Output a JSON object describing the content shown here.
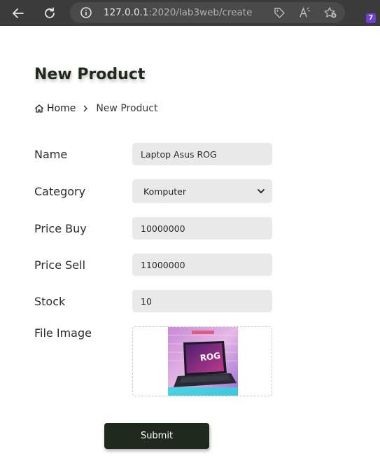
{
  "browser": {
    "url_host": "127.0.0.1",
    "url_rest": ":2020/lab3web/create",
    "extension_badge": "7"
  },
  "page": {
    "title": "New Product",
    "breadcrumb": {
      "home": "Home",
      "current": "New Product"
    }
  },
  "form": {
    "name_label": "Name",
    "name_value": "Laptop Asus ROG",
    "category_label": "Category",
    "category_value": "Komputer",
    "price_buy_label": "Price Buy",
    "price_buy_value": "10000000",
    "price_sell_label": "Price Sell",
    "price_sell_value": "11000000",
    "stock_label": "Stock",
    "stock_value": "10",
    "file_image_label": "File Image",
    "submit_label": "Submit"
  },
  "colors": {
    "primary": "#1f2a1c",
    "field_bg": "#e9e9e9",
    "chrome_bg": "#3b3b3b"
  }
}
